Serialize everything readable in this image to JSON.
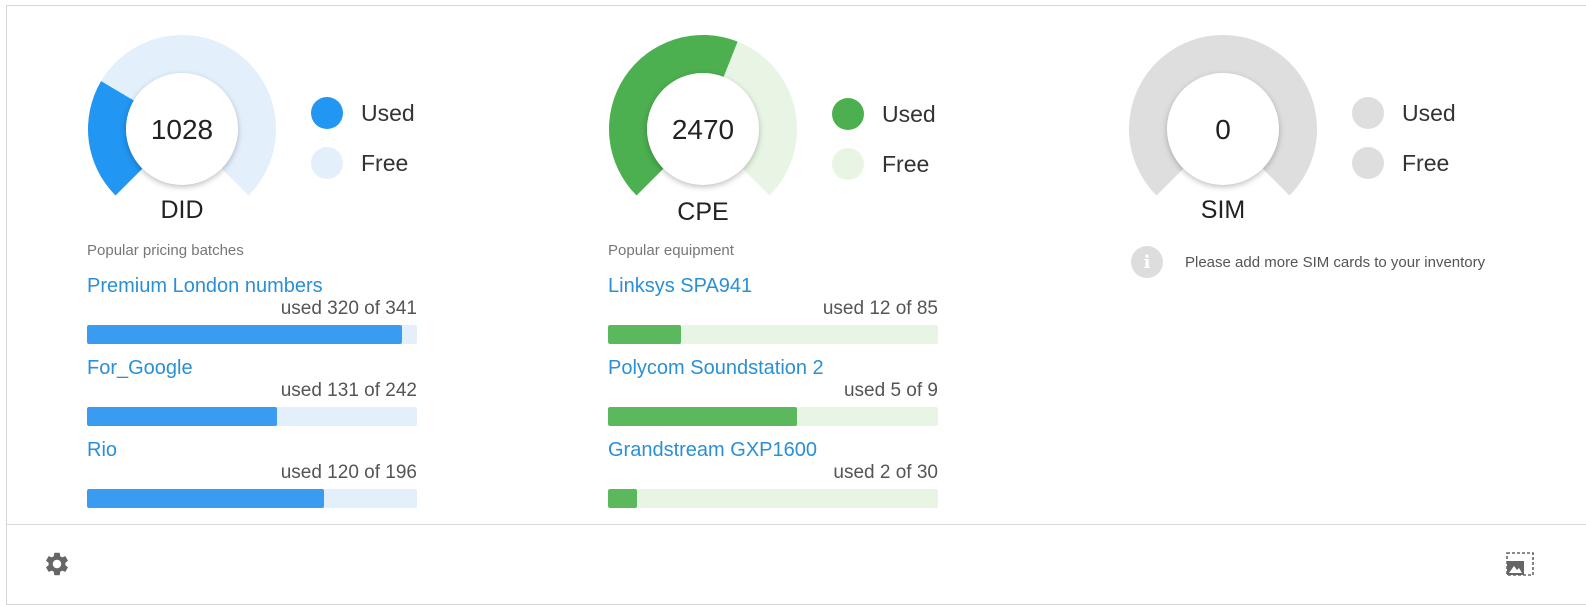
{
  "colors": {
    "did_used": "#2196f3",
    "did_free": "#e3f0fc",
    "cpe_used": "#4caf50",
    "cpe_free": "#e8f5e4",
    "sim_used": "#dedede",
    "sim_free": "#dedede",
    "link": "#2b8fd6"
  },
  "panels": [
    {
      "key": "did",
      "gauge_value": "1028",
      "gauge_label": "DID",
      "used_fraction": 0.28,
      "legend_used": "Used",
      "legend_free": "Free",
      "section_label": "Popular pricing batches",
      "items": [
        {
          "name": "Premium London numbers",
          "used_text": "used 320 of 341",
          "fraction": 0.955
        },
        {
          "name": "For_Google",
          "used_text": "used 131 of 242",
          "fraction": 0.575
        },
        {
          "name": "Rio",
          "used_text": "used 120 of 196",
          "fraction": 0.718
        }
      ]
    },
    {
      "key": "cpe",
      "gauge_value": "2470",
      "gauge_label": "CPE",
      "used_fraction": 0.58,
      "legend_used": "Used",
      "legend_free": "Free",
      "section_label": "Popular equipment",
      "items": [
        {
          "name": "Linksys SPA941",
          "used_text": "used 12 of 85",
          "fraction": 0.22
        },
        {
          "name": "Polycom Soundstation 2",
          "used_text": "used 5 of 9",
          "fraction": 0.574
        },
        {
          "name": "Grandstream GXP1600",
          "used_text": "used 2 of 30",
          "fraction": 0.088
        }
      ]
    },
    {
      "key": "sim",
      "gauge_value": "0",
      "gauge_label": "SIM",
      "used_fraction": 0,
      "legend_used": "Used",
      "legend_free": "Free",
      "note": "Please add more SIM cards to your inventory"
    }
  ],
  "icons": {
    "settings": "gear-icon",
    "image": "image-select-icon",
    "info": "info-icon"
  },
  "info_glyph": "i"
}
